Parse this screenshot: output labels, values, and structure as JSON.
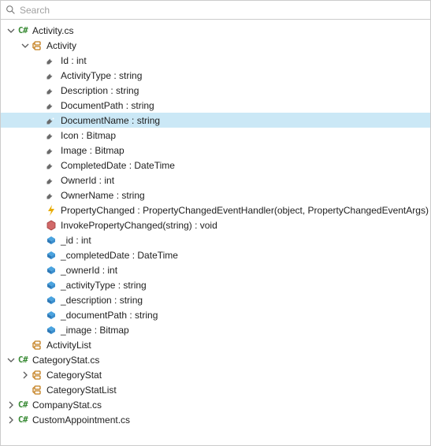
{
  "search": {
    "placeholder": "Search"
  },
  "tree": [
    {
      "depth": 0,
      "expander": "expanded",
      "icon": "csharp",
      "label": "Activity.cs",
      "interact": true
    },
    {
      "depth": 1,
      "expander": "expanded",
      "icon": "class",
      "label": "Activity",
      "interact": true
    },
    {
      "depth": 2,
      "expander": "none",
      "icon": "property",
      "label": "Id : int",
      "interact": true
    },
    {
      "depth": 2,
      "expander": "none",
      "icon": "property",
      "label": "ActivityType : string",
      "interact": true
    },
    {
      "depth": 2,
      "expander": "none",
      "icon": "property",
      "label": "Description : string",
      "interact": true
    },
    {
      "depth": 2,
      "expander": "none",
      "icon": "property",
      "label": "DocumentPath : string",
      "interact": true
    },
    {
      "depth": 2,
      "expander": "none",
      "icon": "property",
      "label": "DocumentName : string",
      "interact": true,
      "selected": true
    },
    {
      "depth": 2,
      "expander": "none",
      "icon": "property",
      "label": "Icon : Bitmap",
      "interact": true
    },
    {
      "depth": 2,
      "expander": "none",
      "icon": "property",
      "label": "Image : Bitmap",
      "interact": true
    },
    {
      "depth": 2,
      "expander": "none",
      "icon": "property",
      "label": "CompletedDate : DateTime",
      "interact": true
    },
    {
      "depth": 2,
      "expander": "none",
      "icon": "property",
      "label": "OwnerId : int",
      "interact": true
    },
    {
      "depth": 2,
      "expander": "none",
      "icon": "property",
      "label": "OwnerName : string",
      "interact": true
    },
    {
      "depth": 2,
      "expander": "none",
      "icon": "event",
      "label": "PropertyChanged : PropertyChangedEventHandler(object, PropertyChangedEventArgs)",
      "interact": true
    },
    {
      "depth": 2,
      "expander": "none",
      "icon": "method",
      "label": "InvokePropertyChanged(string) : void",
      "interact": true
    },
    {
      "depth": 2,
      "expander": "none",
      "icon": "field",
      "label": "_id : int",
      "interact": true
    },
    {
      "depth": 2,
      "expander": "none",
      "icon": "field",
      "label": "_completedDate : DateTime",
      "interact": true
    },
    {
      "depth": 2,
      "expander": "none",
      "icon": "field",
      "label": "_ownerId : int",
      "interact": true
    },
    {
      "depth": 2,
      "expander": "none",
      "icon": "field",
      "label": "_activityType : string",
      "interact": true
    },
    {
      "depth": 2,
      "expander": "none",
      "icon": "field",
      "label": "_description : string",
      "interact": true
    },
    {
      "depth": 2,
      "expander": "none",
      "icon": "field",
      "label": "_documentPath : string",
      "interact": true
    },
    {
      "depth": 2,
      "expander": "none",
      "icon": "field",
      "label": "_image : Bitmap",
      "interact": true
    },
    {
      "depth": 1,
      "expander": "none",
      "icon": "class",
      "label": "ActivityList",
      "interact": true
    },
    {
      "depth": 0,
      "expander": "expanded",
      "icon": "csharp",
      "label": "CategoryStat.cs",
      "interact": true
    },
    {
      "depth": 1,
      "expander": "collapsed",
      "icon": "class",
      "label": "CategoryStat",
      "interact": true
    },
    {
      "depth": 1,
      "expander": "none",
      "icon": "class",
      "label": "CategoryStatList",
      "interact": true
    },
    {
      "depth": 0,
      "expander": "collapsed",
      "icon": "csharp",
      "label": "CompanyStat.cs",
      "interact": true
    },
    {
      "depth": 0,
      "expander": "collapsed",
      "icon": "csharp",
      "label": "CustomAppointment.cs",
      "interact": true
    }
  ]
}
